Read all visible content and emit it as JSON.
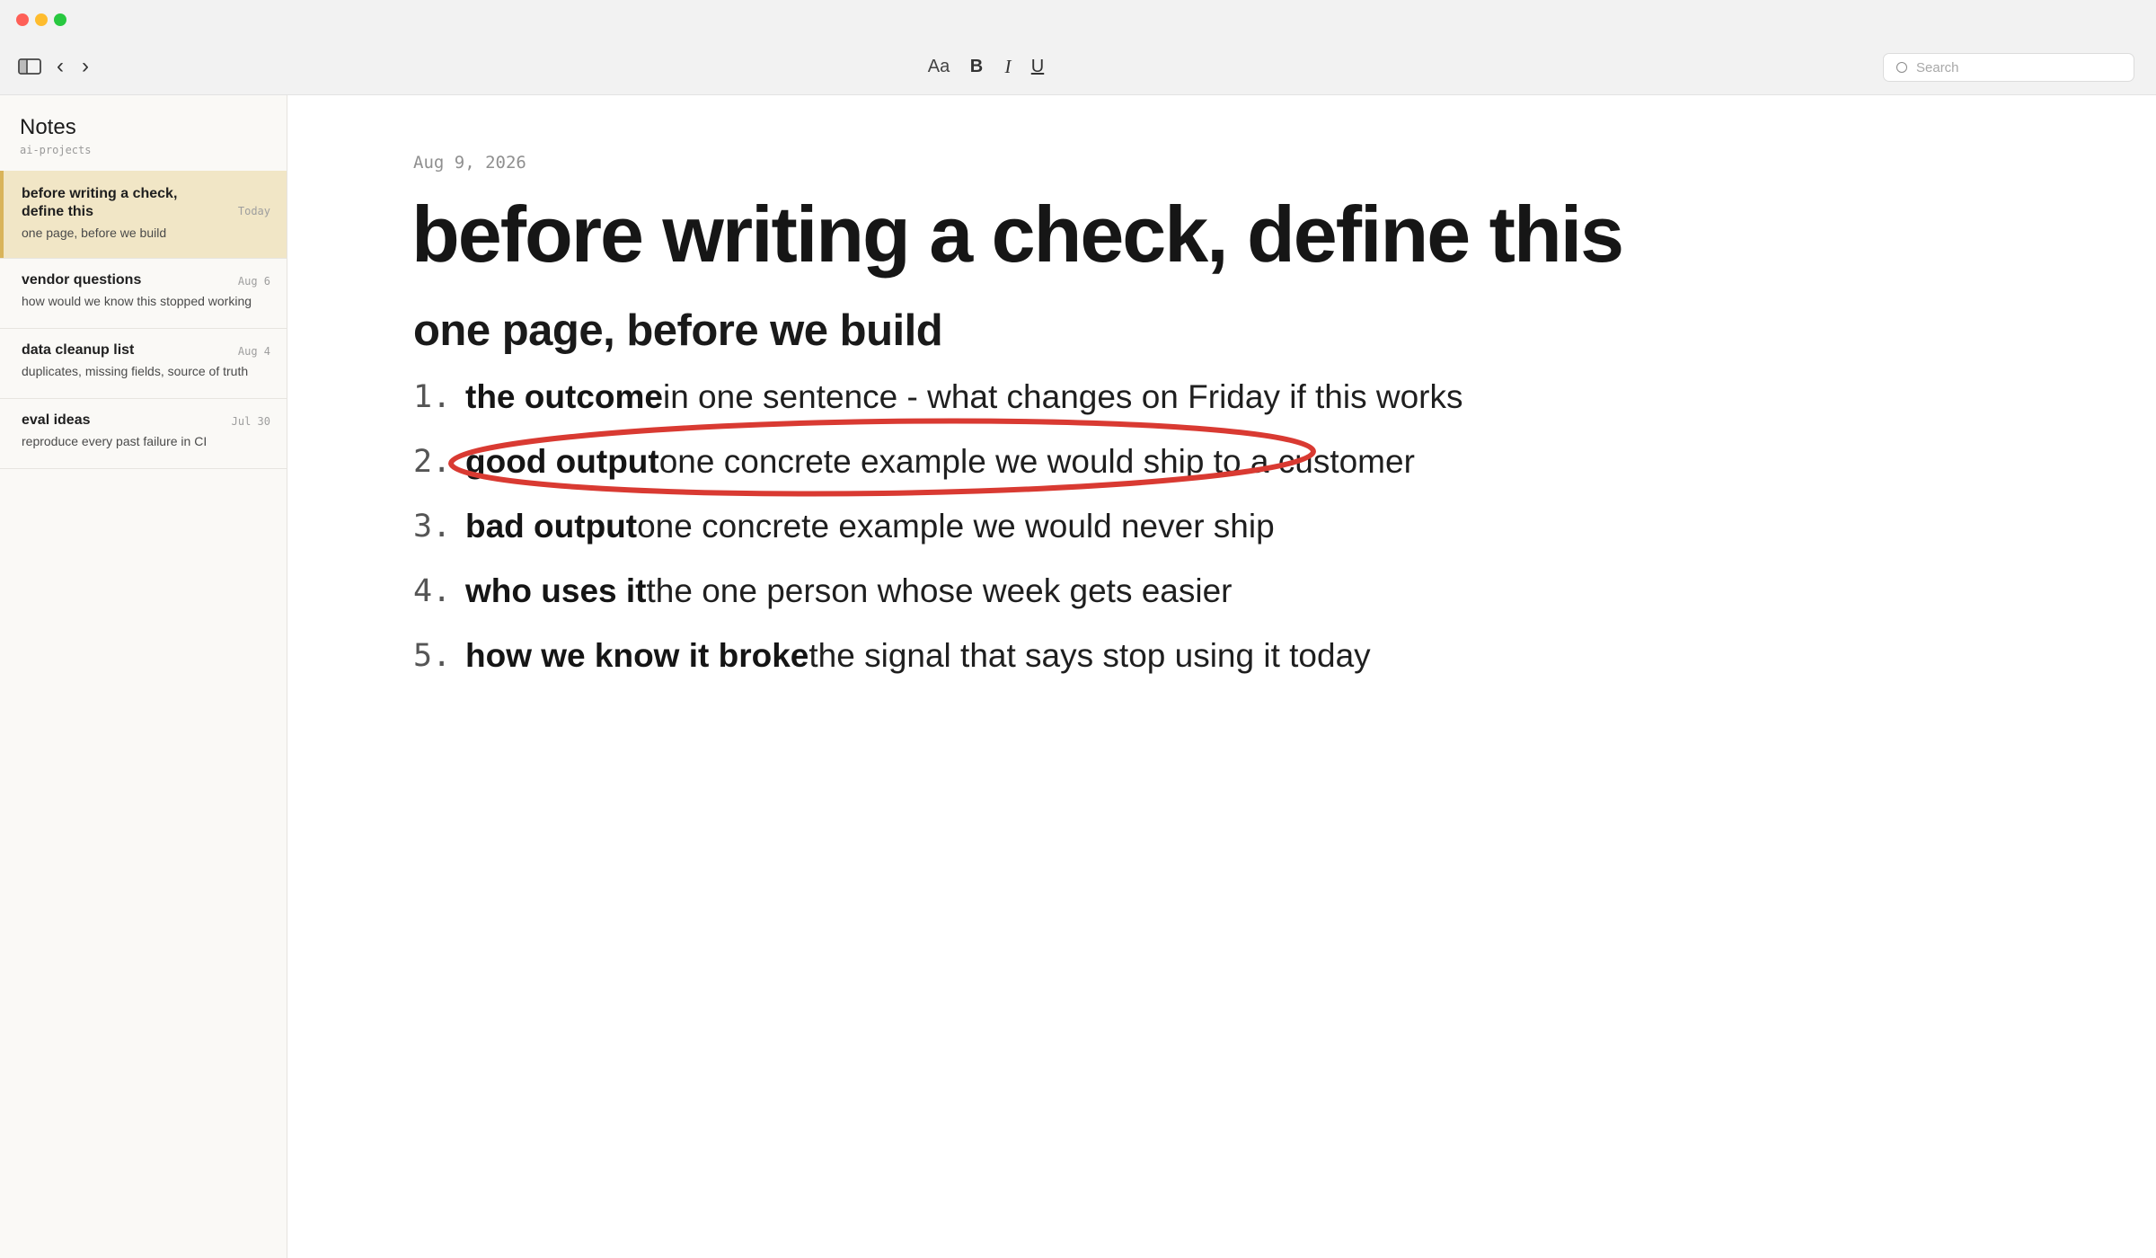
{
  "window": {
    "traffic_lights": {
      "close": "#fe5f57",
      "minimize": "#febc2e",
      "maximize": "#28c840"
    }
  },
  "toolbar": {
    "sidebar_icon": "sidebar-icon",
    "back": "‹",
    "forward": "›",
    "format": {
      "font": "Aa",
      "bold": "B",
      "italic": "I",
      "underline": "U"
    },
    "search_placeholder": "Search"
  },
  "sidebar": {
    "title": "Notes",
    "subtitle": "ai-projects",
    "accent": "#d9b45a",
    "notes": [
      {
        "title": "before writing a check, define this",
        "date": "Today",
        "preview": "one page, before we build"
      },
      {
        "title": "vendor questions",
        "date": "Aug 6",
        "preview": "how would we know this stopped working"
      },
      {
        "title": "data cleanup list",
        "date": "Aug 4",
        "preview": "duplicates, missing fields, source of truth"
      },
      {
        "title": "eval ideas",
        "date": "Jul 30",
        "preview": "reproduce every past failure in CI"
      }
    ]
  },
  "document": {
    "date": "Aug 9, 2026",
    "title": "before writing a check, define this",
    "subtitle": "one page, before we build",
    "items": [
      {
        "num": "1.",
        "term": "the outcome",
        "text": "in one sentence - what changes on Friday if this works"
      },
      {
        "num": "2.",
        "term": "good output",
        "text": "one concrete example we would ship to a customer"
      },
      {
        "num": "3.",
        "term": "bad output",
        "text": "one concrete example we would never ship"
      },
      {
        "num": "4.",
        "term": "who uses it",
        "text": "the one person whose week gets easier"
      },
      {
        "num": "5.",
        "term": "how we know it broke",
        "text": "the signal that says stop using it today"
      }
    ],
    "annotation_color": "#d93a32"
  }
}
